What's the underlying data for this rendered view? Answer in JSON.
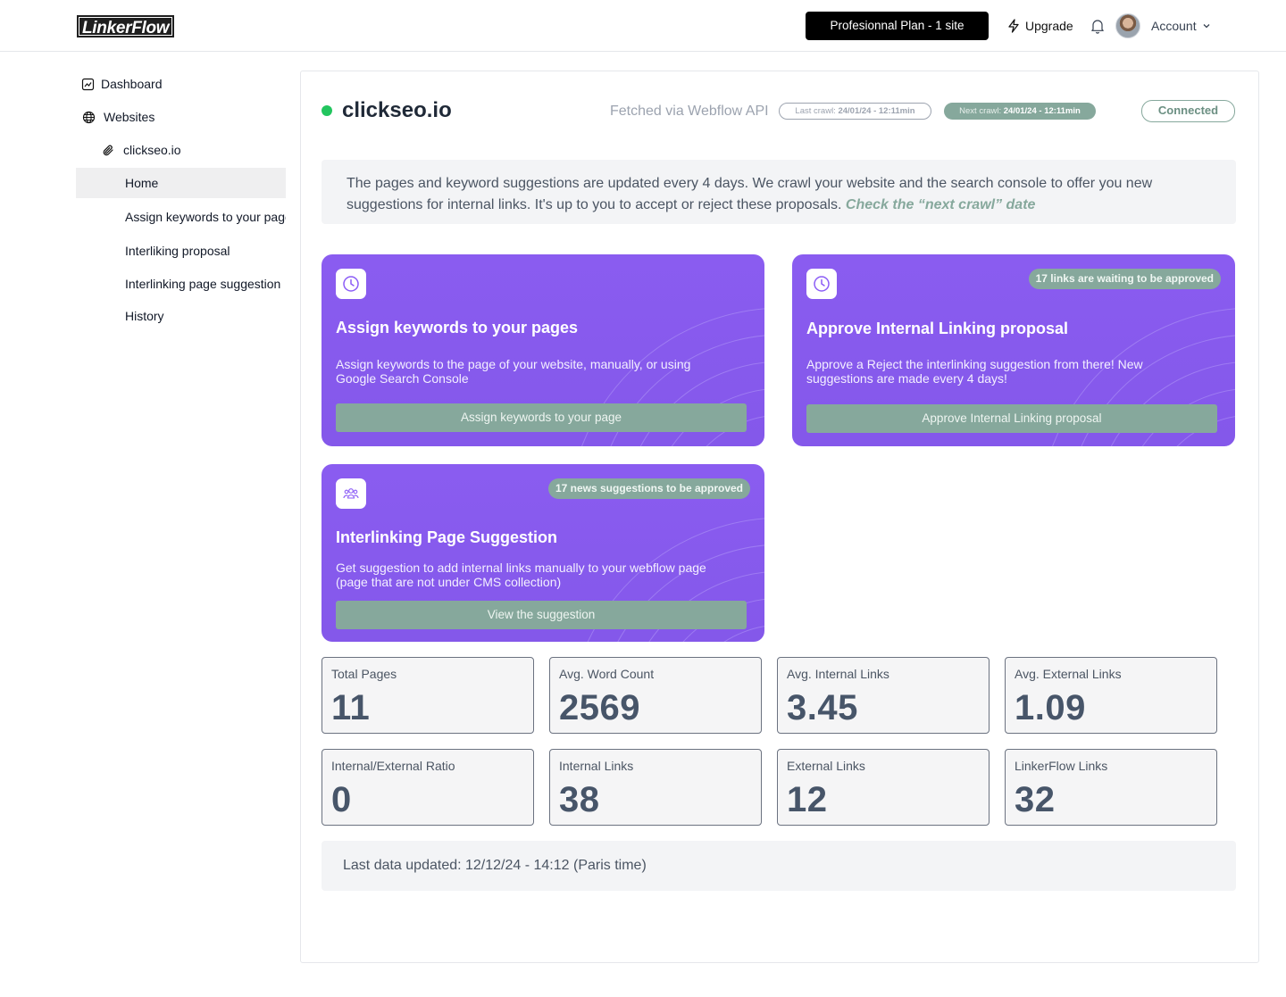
{
  "header": {
    "logo": "LinkerFlow",
    "plan_label": "Profesionnal Plan - 1 site",
    "upgrade_label": "Upgrade",
    "account_label": "Account"
  },
  "sidebar": {
    "items": [
      {
        "label": "Dashboard",
        "icon": "dashboard-icon"
      },
      {
        "label": "Websites",
        "icon": "globe-icon"
      },
      {
        "label": "clickseo.io",
        "icon": "paperclip-icon"
      },
      {
        "label": "Home",
        "active": true
      },
      {
        "label": "Assign keywords to your pages"
      },
      {
        "label": "Interliking proposal"
      },
      {
        "label": "Interlinking page suggestion"
      },
      {
        "label": "History"
      }
    ]
  },
  "site": {
    "name": "clickseo.io",
    "status_color": "#22c55e",
    "fetched_via": "Fetched via Webflow API",
    "last_crawl_label": "Last crawl:",
    "last_crawl_value": "24/01/24 - 12:11min",
    "next_crawl_label": "Next crawl:",
    "next_crawl_value": "24/01/24 - 12:11min",
    "connection_status": "Connected"
  },
  "info": {
    "text": "The pages and keyword suggestions are updated every 4 days. We crawl your website and the search console to offer you new suggestions for internal links. It's up to you to accept or reject these proposals. ",
    "emphasis": "Check the “next crawl” date"
  },
  "cards": [
    {
      "title": "Assign keywords to your pages",
      "description": "Assign keywords to the page of your website, manually, or using Google Search Console",
      "cta": "Assign keywords to your page",
      "icon": "clock-icon",
      "badge": ""
    },
    {
      "title": "Approve Internal Linking proposal",
      "description": "Approve a Reject the interlinking suggestion from there! New suggestions are made every 4 days!",
      "cta": "Approve Internal Linking proposal",
      "icon": "clock-icon",
      "badge": "17 links are waiting to be approved"
    },
    {
      "title": "Interlinking Page Suggestion",
      "description": "Get suggestion to add internal links manually to your webflow page (page that are not under CMS collection)",
      "cta": "View the suggestion",
      "icon": "users-icon",
      "badge": "17 news suggestions to be approved"
    }
  ],
  "stats": [
    {
      "label": "Total Pages",
      "value": "11"
    },
    {
      "label": "Avg. Word Count",
      "value": "2569"
    },
    {
      "label": "Avg. Internal Links",
      "value": "3.45"
    },
    {
      "label": "Avg. External Links",
      "value": "1.09"
    },
    {
      "label": "Internal/External Ratio",
      "value": "0"
    },
    {
      "label": "Internal Links",
      "value": "38"
    },
    {
      "label": "External Links",
      "value": "12"
    },
    {
      "label": "LinkerFlow Links",
      "value": "32"
    }
  ],
  "footer": {
    "last_updated": "Last data updated: 12/12/24 - 14:12 (Paris time)"
  },
  "colors": {
    "accent_purple": "#8b5cf6",
    "sage_green": "#86a89c",
    "status_green": "#22c55e"
  }
}
